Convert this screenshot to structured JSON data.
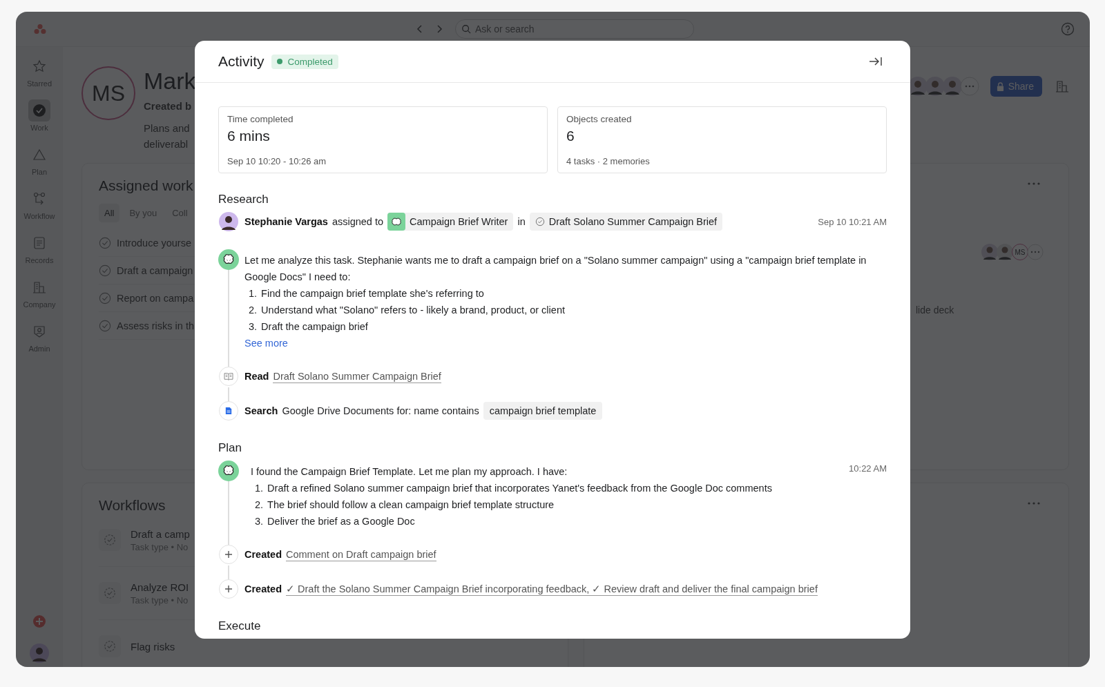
{
  "app": {
    "search": {
      "placeholder": "Ask or search"
    },
    "sidebar": [
      {
        "label": "Starred",
        "kind": "star",
        "selected": false
      },
      {
        "label": "Work",
        "kind": "check",
        "selected": true
      },
      {
        "label": "Plan",
        "kind": "triangle",
        "selected": false
      },
      {
        "label": "Workflow",
        "kind": "flow",
        "selected": false
      },
      {
        "label": "Records",
        "kind": "records",
        "selected": false
      },
      {
        "label": "Company",
        "kind": "company",
        "selected": false
      },
      {
        "label": "Admin",
        "kind": "admin",
        "selected": false
      }
    ],
    "profile": {
      "initials": "MS",
      "name": "Mark",
      "byline": "Created b",
      "description": [
        "Plans and",
        "deliverabl"
      ]
    },
    "share": "Share",
    "assigned_work": {
      "title": "Assigned work",
      "tabs": [
        {
          "label": "All",
          "selected": true
        },
        {
          "label": "By you",
          "selected": false
        },
        {
          "label": "Coll",
          "selected": false
        }
      ],
      "tasks": [
        "Introduce yourse",
        "Draft a campaign",
        "Report on campa",
        "Assess risks in th"
      ],
      "assignee_initials": "MS",
      "side_text": "lide deck"
    },
    "workflows": {
      "title": "Workflows",
      "items": [
        {
          "name": "Draft a camp",
          "meta": "Task type • No"
        },
        {
          "name": "Analyze ROI",
          "meta": "Task type • No"
        },
        {
          "name": "Flag risks"
        }
      ]
    }
  },
  "activity": {
    "title": "Activity",
    "status": {
      "label": "Completed",
      "color": "#3d9b6c"
    },
    "stats": [
      {
        "label": "Time completed",
        "value": "6 mins",
        "detail": "Sep 10 10:20 - 10:26 am"
      },
      {
        "label": "Objects created",
        "value": "6",
        "detail": "4 tasks · 2 memories"
      }
    ],
    "sections": [
      {
        "title": "Research",
        "events": [
          {
            "kind": "assignment",
            "actor": "Stephanie Vargas",
            "verb": "assigned to",
            "agent": "Campaign Brief Writer",
            "prep": "in",
            "task": "Draft Solano Summer Campaign Brief",
            "time": "Sep 10 10:21 AM"
          },
          {
            "kind": "thought",
            "text": "Let me analyze this task. Stephanie wants me to draft a campaign brief on a \"Solano summer campaign\" using a \"campaign brief template in Google Docs\" I need to:",
            "steps": [
              {
                "number": "1.",
                "text": "Find the campaign brief template she's referring to"
              },
              {
                "number": "2.",
                "text": "Understand what \"Solano\" refers to - likely a brand, product, or client"
              },
              {
                "number": "3.",
                "text": "Draft the campaign brief"
              }
            ],
            "more": "See more"
          },
          {
            "kind": "read",
            "verb": "Read",
            "link": "Draft Solano Summer Campaign Brief"
          },
          {
            "kind": "search",
            "verb": "Search",
            "text": "Google Drive Documents for: name contains",
            "query": "campaign brief template"
          }
        ]
      },
      {
        "title": "Plan",
        "events": [
          {
            "kind": "thought",
            "text": "I found the Campaign Brief Template. Let me plan my approach. I have:",
            "steps": [
              {
                "number": "1.",
                "text": "Draft a refined Solano summer campaign brief that incorporates Yanet's feedback from the Google Doc comments"
              },
              {
                "number": "2.",
                "text": "The brief should follow a clean campaign brief template structure"
              },
              {
                "number": "3.",
                "text": "Deliver the brief as a Google Doc"
              }
            ],
            "time": "10:22 AM"
          },
          {
            "kind": "created",
            "verb": "Created",
            "link": "Comment on Draft campaign brief"
          },
          {
            "kind": "created",
            "verb": "Created",
            "link": "✓ Draft the Solano Summer Campaign Brief incorporating feedback, ✓ Review draft and deliver the final campaign brief"
          }
        ]
      },
      {
        "title": "Execute"
      }
    ]
  }
}
